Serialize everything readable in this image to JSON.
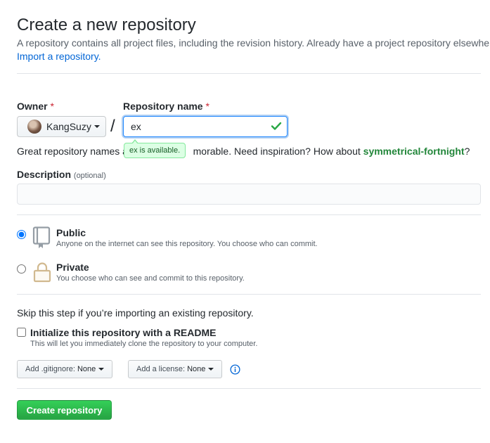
{
  "header": {
    "title": "Create a new repository",
    "subtitle": "A repository contains all project files, including the revision history. Already have a project repository elsewhere?",
    "import_link": "Import a repository."
  },
  "owner": {
    "label": "Owner",
    "required_mark": "*",
    "selected": "KangSuzy"
  },
  "separator": "/",
  "repo_name": {
    "label": "Repository name",
    "required_mark": "*",
    "value": "ex",
    "availability": "ex is available.",
    "status_color": "#28a745"
  },
  "name_help": {
    "before": "Great repository names ar",
    "after": "morable. Need inspiration? How about ",
    "suggestion": "symmetrical-fortnight",
    "end": "?"
  },
  "description": {
    "label": "Description",
    "optional": "(optional)",
    "value": ""
  },
  "visibility": {
    "selected": "public",
    "public": {
      "title": "Public",
      "note": "Anyone on the internet can see this repository. You choose who can commit."
    },
    "private": {
      "title": "Private",
      "note": "You choose who can see and commit to this repository."
    }
  },
  "init": {
    "skip_text": "Skip this step if you’re importing an existing repository.",
    "readme_label": "Initialize this repository with a README",
    "readme_note": "This will let you immediately clone the repository to your computer.",
    "readme_checked": false,
    "gitignore_label": "Add .gitignore:",
    "gitignore_value": "None",
    "license_label": "Add a license:",
    "license_value": "None"
  },
  "submit": {
    "label": "Create repository",
    "color": "#28a745"
  },
  "colors": {
    "link": "#0366d6",
    "required": "#cb2431",
    "muted": "#586069",
    "available_bg": "#dcffe4"
  }
}
